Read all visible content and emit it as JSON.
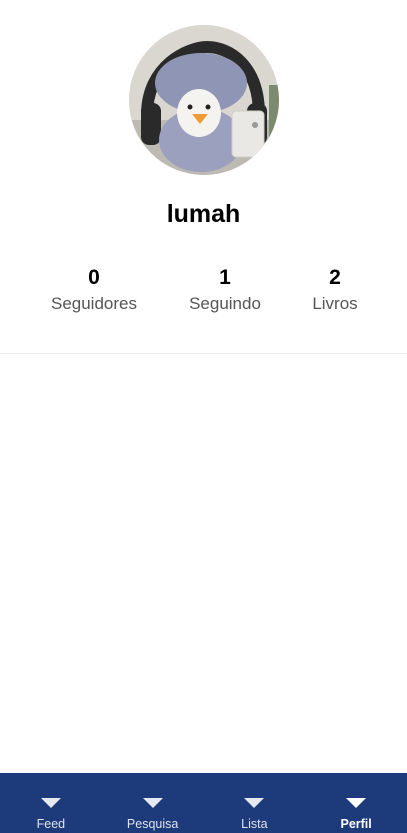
{
  "profile": {
    "username": "lumah",
    "stats": [
      {
        "count": "0",
        "label": "Seguidores"
      },
      {
        "count": "1",
        "label": "Seguindo"
      },
      {
        "count": "2",
        "label": "Livros"
      }
    ]
  },
  "bottom_nav": {
    "items": [
      {
        "label": "Feed",
        "icon": "chevron-down-icon"
      },
      {
        "label": "Pesquisa",
        "icon": "chevron-down-icon"
      },
      {
        "label": "Lista",
        "icon": "chevron-down-icon"
      },
      {
        "label": "Perfil",
        "icon": "chevron-down-icon"
      }
    ],
    "active": "Perfil",
    "background_color": "#1d3a7a"
  }
}
